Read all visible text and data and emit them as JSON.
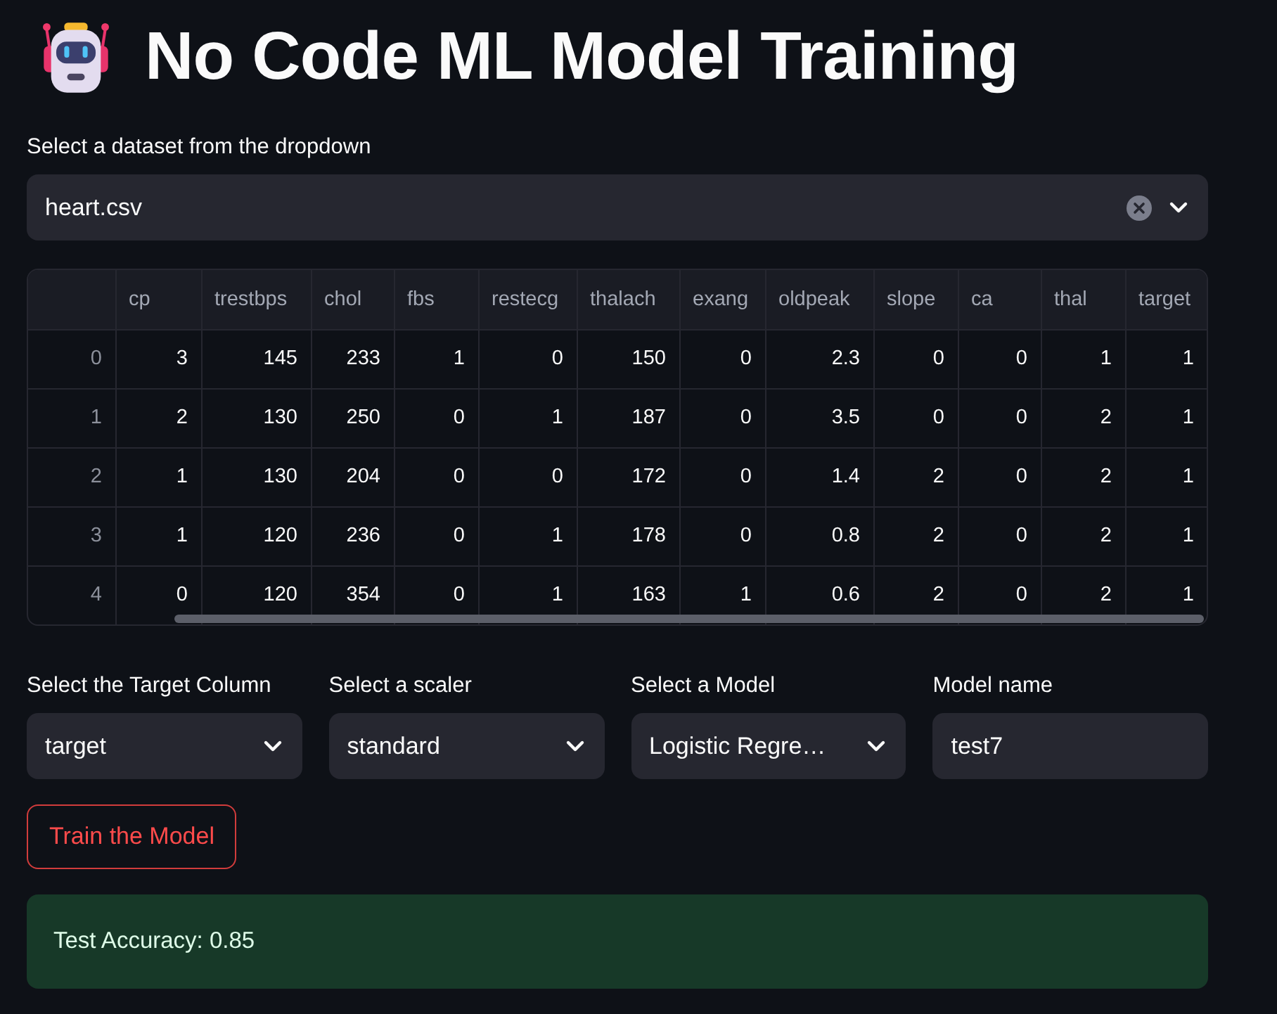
{
  "title": {
    "text": "No Code ML Model Training"
  },
  "dataset": {
    "label": "Select a dataset from the dropdown",
    "value": "heart.csv",
    "clearable": true
  },
  "table": {
    "columns": [
      "cp",
      "trestbps",
      "chol",
      "fbs",
      "restecg",
      "thalach",
      "exang",
      "oldpeak",
      "slope",
      "ca",
      "thal",
      "target"
    ],
    "rows": [
      {
        "index": "0",
        "cells": [
          "3",
          "145",
          "233",
          "1",
          "0",
          "150",
          "0",
          "2.3",
          "0",
          "0",
          "1",
          "1"
        ]
      },
      {
        "index": "1",
        "cells": [
          "2",
          "130",
          "250",
          "0",
          "1",
          "187",
          "0",
          "3.5",
          "0",
          "0",
          "2",
          "1"
        ]
      },
      {
        "index": "2",
        "cells": [
          "1",
          "130",
          "204",
          "0",
          "0",
          "172",
          "0",
          "1.4",
          "2",
          "0",
          "2",
          "1"
        ]
      },
      {
        "index": "3",
        "cells": [
          "1",
          "120",
          "236",
          "0",
          "1",
          "178",
          "0",
          "0.8",
          "2",
          "0",
          "2",
          "1"
        ]
      },
      {
        "index": "4",
        "cells": [
          "0",
          "120",
          "354",
          "0",
          "1",
          "163",
          "1",
          "0.6",
          "2",
          "0",
          "2",
          "1"
        ]
      }
    ]
  },
  "controls": [
    {
      "kind": "select",
      "label": "Select the Target Column",
      "value": "target"
    },
    {
      "kind": "select",
      "label": "Select a scaler",
      "value": "standard"
    },
    {
      "kind": "select",
      "label": "Select a Model",
      "value": "Logistic Regre…"
    },
    {
      "kind": "text_input",
      "label": "Model name",
      "value": "test7"
    }
  ],
  "train_button": {
    "label": "Train the Model"
  },
  "result": {
    "kind": "success",
    "text": "Test Accuracy: 0.85"
  }
}
